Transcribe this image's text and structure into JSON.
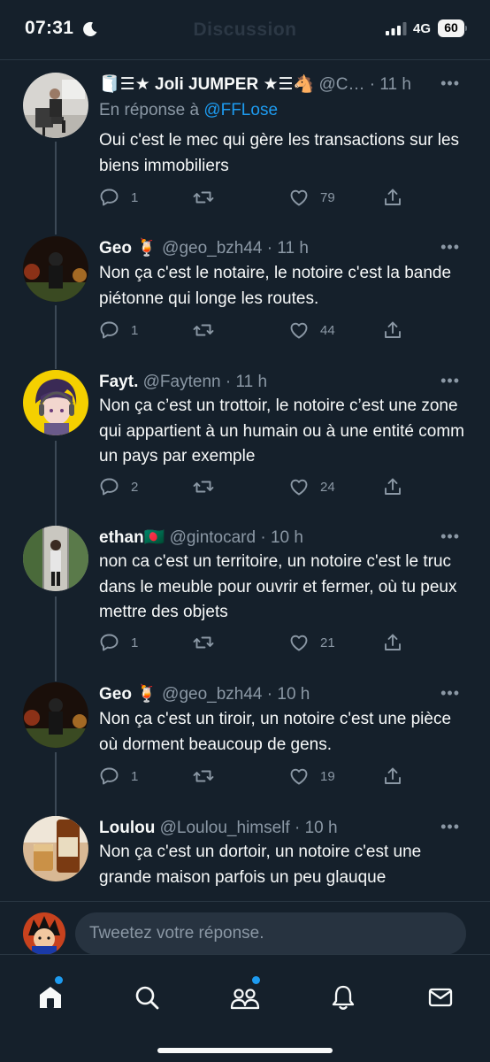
{
  "status_bar": {
    "time": "07:31",
    "network": "4G",
    "battery": "60",
    "header_title": "Discussion"
  },
  "colors": {
    "background": "#15202b",
    "accent": "#1d9bf0",
    "muted": "#8b98a5"
  },
  "tweets": [
    {
      "name": "🧻☰★ Joli JUMPER ★☰🐴",
      "handle": "@C…",
      "time": "11 h",
      "reply_prefix": "En réponse à",
      "reply_to": "@FFLose",
      "text": "Oui c'est le mec qui gère les transactions sur les biens immobiliers",
      "replies": "1",
      "retweets": "",
      "likes": "79"
    },
    {
      "name": "Geo 🍹",
      "handle": "@geo_bzh44",
      "time": "11 h",
      "text": "Non ça c'est le notaire, le notoire c'est la bande piétonne qui longe les routes.",
      "replies": "1",
      "retweets": "",
      "likes": "44"
    },
    {
      "name": "Fayt.",
      "handle": "@Faytenn",
      "time": "11 h",
      "text": "Non ça c’est un trottoir, le notoire c’est une zone qui appartient à un humain ou à une entité comm un pays par exemple",
      "replies": "2",
      "retweets": "",
      "likes": "24"
    },
    {
      "name": "ethan🇧🇩",
      "handle": "@gintocard",
      "time": "10 h",
      "text": "non ca c'est un territoire, un notoire c'est le truc dans le meuble pour ouvrir et fermer, où tu peux mettre des objets",
      "replies": "1",
      "retweets": "",
      "likes": "21"
    },
    {
      "name": "Geo 🍹",
      "handle": "@geo_bzh44",
      "time": "10 h",
      "text": "Non ça c'est un tiroir, un notoire c'est une pièce où dorment beaucoup de gens.",
      "replies": "1",
      "retweets": "",
      "likes": "19"
    },
    {
      "name": "Loulou",
      "handle": "@Loulou_himself",
      "time": "10 h",
      "text": "Non ça c'est un dortoir, un notoire c'est une grande maison parfois un peu glauque",
      "replies": "",
      "retweets": "",
      "likes": ""
    }
  ],
  "reply_box": {
    "placeholder": "Tweetez votre réponse."
  },
  "tab_bar": {
    "items": [
      {
        "icon": "home-icon",
        "active": true,
        "badge": true
      },
      {
        "icon": "search-icon",
        "active": false,
        "badge": false
      },
      {
        "icon": "communities-icon",
        "active": false,
        "badge": true
      },
      {
        "icon": "bell-icon",
        "active": false,
        "badge": false
      },
      {
        "icon": "mail-icon",
        "active": false,
        "badge": false
      }
    ]
  }
}
